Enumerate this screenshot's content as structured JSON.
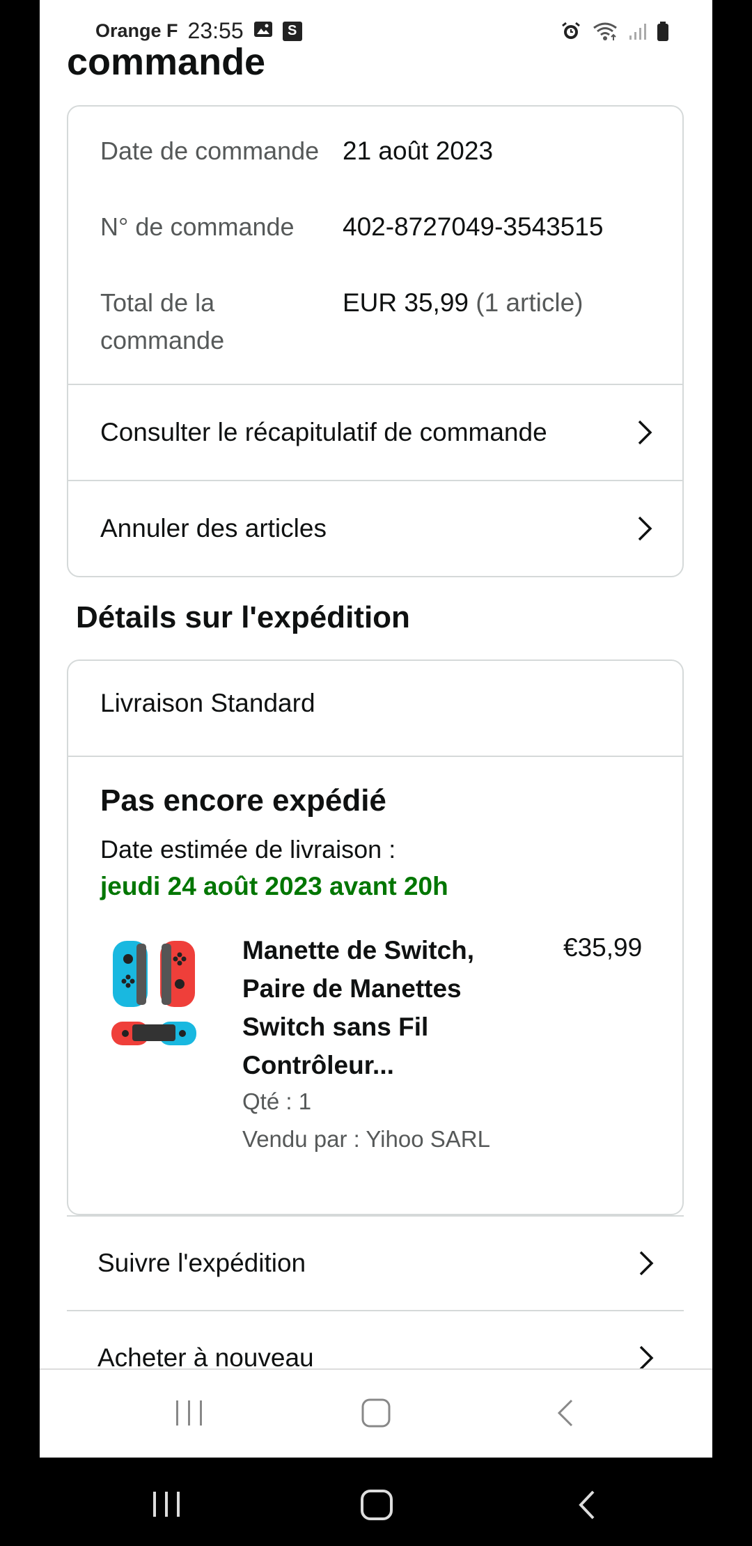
{
  "status_bar": {
    "carrier": "Orange F",
    "time": "23:55",
    "notif_icons": [
      "image-icon",
      "s-app-icon"
    ],
    "notif_s": "S",
    "right_icons": [
      "alarm-icon",
      "wifi-icon",
      "signal-icon",
      "battery-icon"
    ]
  },
  "page": {
    "title": "commande"
  },
  "order_info": {
    "rows": [
      {
        "label": "Date de commande",
        "value": "21 août 2023"
      },
      {
        "label": "N° de commande",
        "value": "402-8727049-3543515"
      },
      {
        "label": "Total de la commande",
        "value": "EUR 35,99",
        "value_suffix": "(1 article)"
      }
    ],
    "links": [
      {
        "label": "Consulter le récapitulatif de commande"
      },
      {
        "label": "Annuler des articles"
      }
    ]
  },
  "shipment": {
    "section_title": "Détails sur l'expédition",
    "method": "Livraison Standard",
    "status": "Pas encore expédié",
    "estimate_label": "Date estimée de livraison :",
    "estimate_date": "jeudi 24 août 2023 avant 20h",
    "accent_color": "#007600",
    "item": {
      "title": "Manette de Switch, Paire de Manettes Switch sans Fil Contrôleur...",
      "price": "€35,99",
      "qty": "Qté : 1",
      "seller": "Vendu par : Yihoo SARL"
    }
  },
  "actions": [
    {
      "label": "Suivre l'expédition"
    },
    {
      "label": "Acheter à nouveau"
    }
  ],
  "system_nav": [
    "recents-icon",
    "home-icon",
    "back-icon"
  ]
}
